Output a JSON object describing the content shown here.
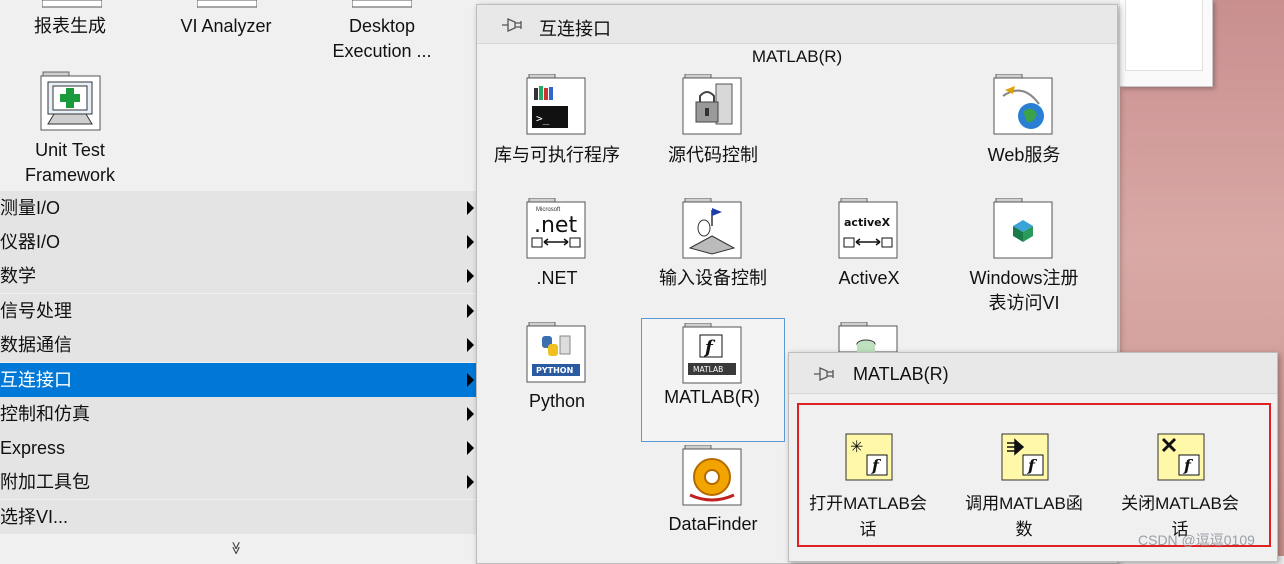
{
  "left_palette": {
    "top_tiles": [
      "报表生成",
      "VI Analyzer",
      "Desktop\nExecution ..."
    ],
    "unit_test_tile": "Unit Test\nFramework",
    "menu": [
      {
        "label": "测量I/O",
        "selected": false
      },
      {
        "label": "仪器I/O",
        "selected": false
      },
      {
        "label": "数学",
        "selected": false
      },
      {
        "label": "信号处理",
        "selected": false
      },
      {
        "label": "数据通信",
        "selected": false
      },
      {
        "label": "互连接口",
        "selected": true
      },
      {
        "label": "控制和仿真",
        "selected": false
      },
      {
        "label": "Express",
        "selected": false
      },
      {
        "label": "附加工具包",
        "selected": false
      },
      {
        "label": "选择VI...",
        "selected": false
      }
    ],
    "more_glyph": "≫"
  },
  "main_panel": {
    "title": "互连接口",
    "subtitle": "MATLAB(R)",
    "tiles": {
      "libraries": "库与可执行程序",
      "source_control": "源代码控制",
      "web_services": "Web服务",
      "dotnet": ".NET",
      "input_device": "输入设备控制",
      "activex": "ActiveX",
      "windows_registry": "Windows注册\n表访问VI",
      "python": "Python",
      "matlab": "MATLAB(R)",
      "datafinder": "DataFinder"
    },
    "icon_text": {
      "net_small": "Microsoft",
      "net_big": ".net",
      "activex": "activeX",
      "python": "PYTHON",
      "matlab": "MATLAB"
    }
  },
  "matlab_panel": {
    "title": "MATLAB(R)",
    "tiles": [
      "打开MATLAB会\n话",
      "调用MATLAB函\n数",
      "关闭MATLAB会\n话"
    ]
  },
  "watermark": "CSDN @逗逗0109",
  "colors": {
    "selection": "#0078d7",
    "highlight_frame": "#e02020",
    "hover_frame": "#5b9bd5",
    "matlab_icon_bg": "#fff8a8"
  }
}
